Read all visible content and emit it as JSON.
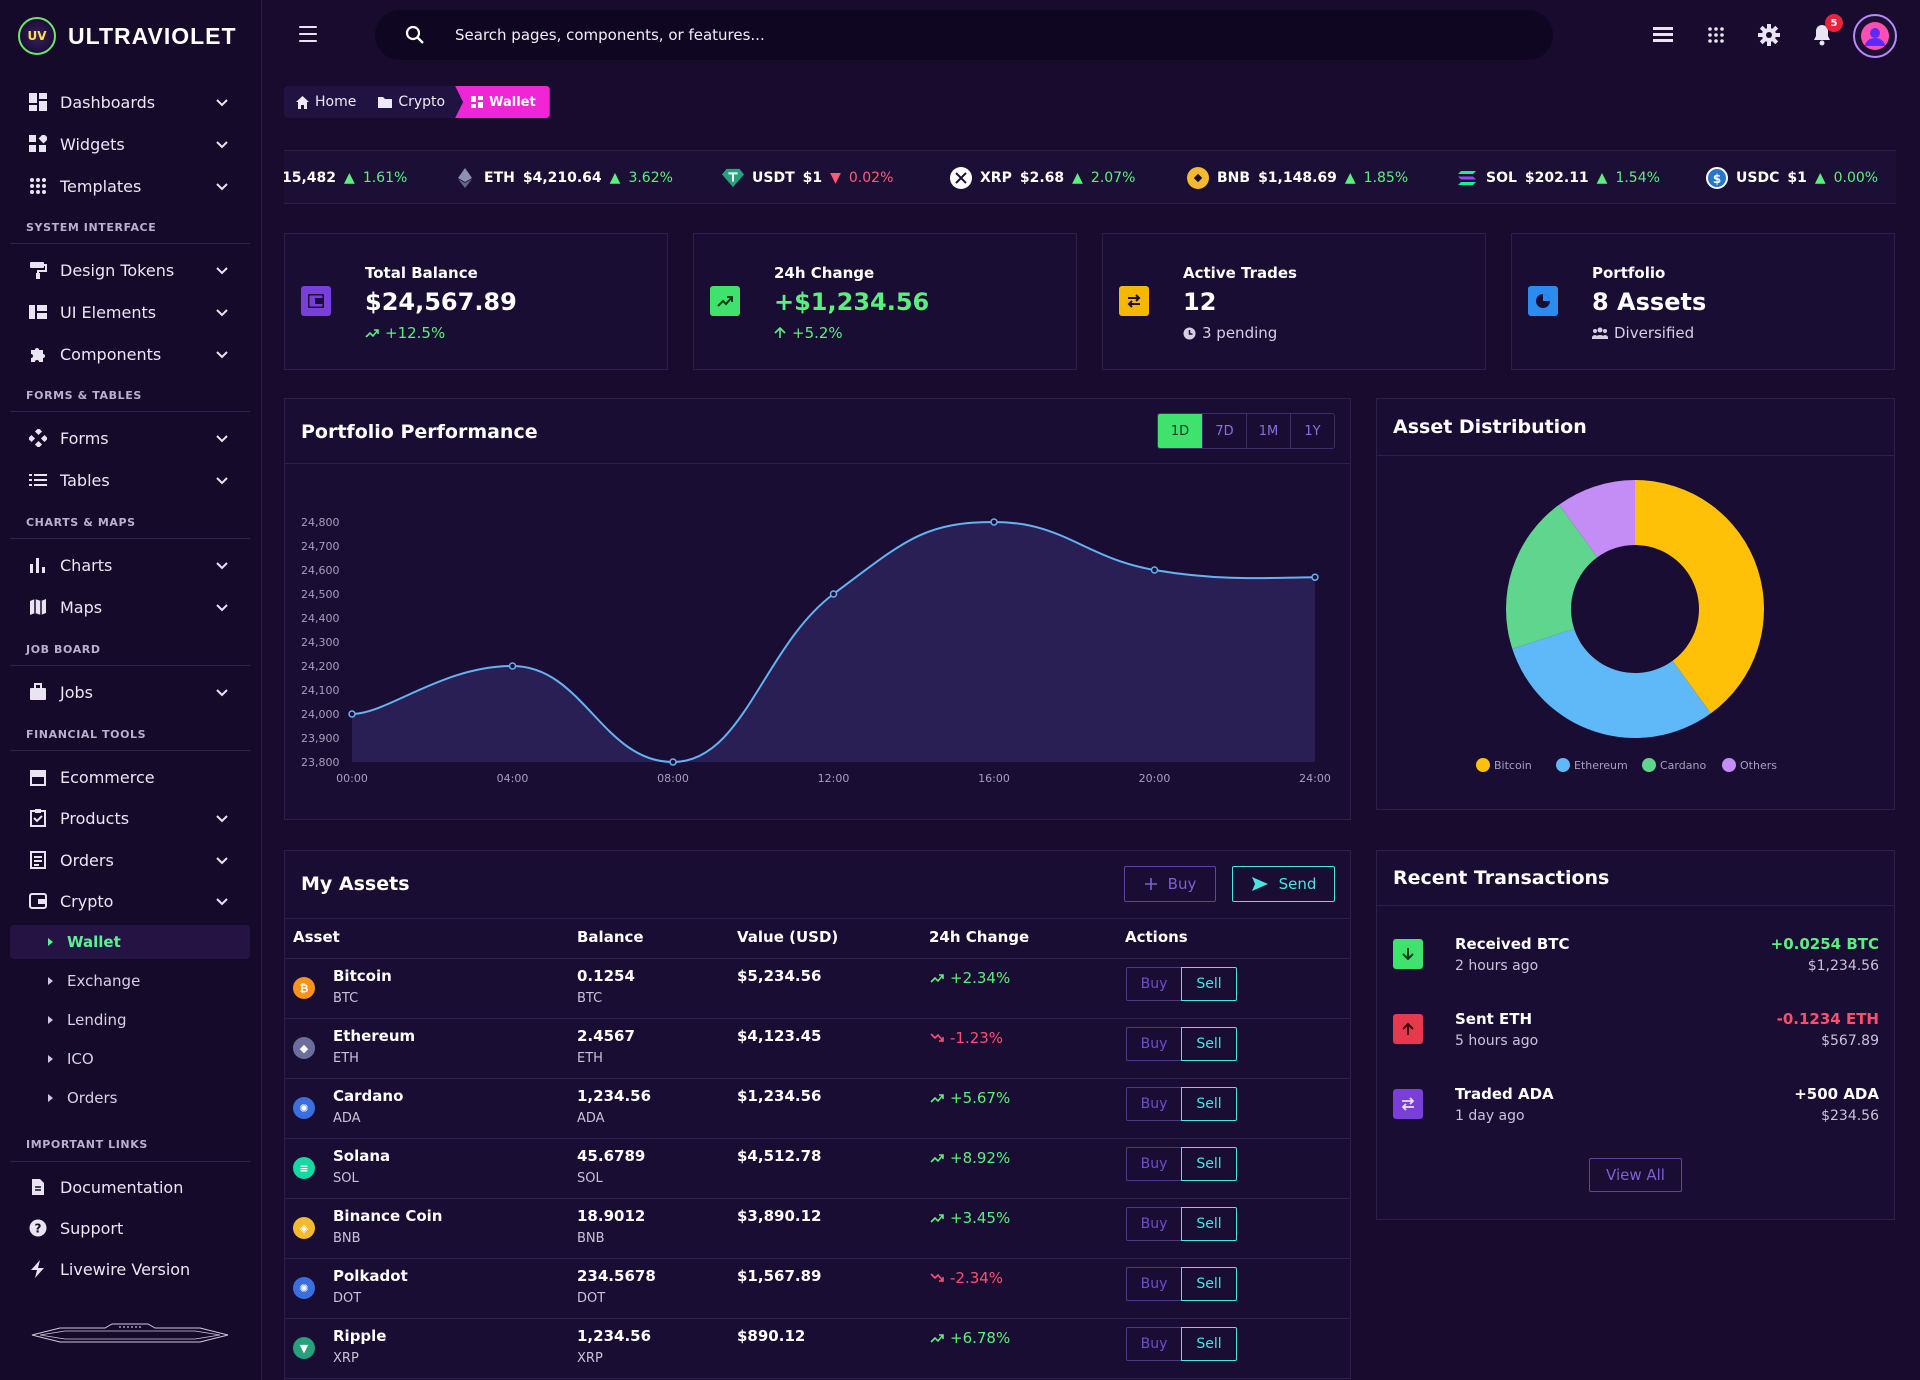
{
  "app": {
    "logo_badge": "UV",
    "name": "ULTRAVIOLET"
  },
  "sidebar": {
    "items": [
      {
        "label": "Dashboards",
        "icon": "dashboard-icon"
      },
      {
        "label": "Widgets",
        "icon": "widgets-icon"
      },
      {
        "label": "Templates",
        "icon": "grid-icon"
      },
      {
        "label": "Design Tokens",
        "icon": "paint-roller-icon"
      },
      {
        "label": "UI Elements",
        "icon": "ui-elements-icon"
      },
      {
        "label": "Components",
        "icon": "puzzle-icon"
      },
      {
        "label": "Forms",
        "icon": "forms-icon"
      },
      {
        "label": "Tables",
        "icon": "tables-icon"
      },
      {
        "label": "Charts",
        "icon": "bar-chart-icon"
      },
      {
        "label": "Maps",
        "icon": "map-icon"
      },
      {
        "label": "Jobs",
        "icon": "briefcase-icon"
      },
      {
        "label": "Ecommerce",
        "icon": "storefront-icon"
      },
      {
        "label": "Products",
        "icon": "products-icon"
      },
      {
        "label": "Orders",
        "icon": "orders-icon"
      },
      {
        "label": "Crypto",
        "icon": "wallet-icon"
      },
      {
        "label": "Documentation",
        "icon": "document-icon"
      },
      {
        "label": "Support",
        "icon": "help-icon"
      },
      {
        "label": "Livewire Version",
        "icon": "bolt-icon"
      }
    ],
    "sections": [
      "SYSTEM INTERFACE",
      "FORMS & TABLES",
      "CHARTS & MAPS",
      "JOB BOARD",
      "FINANCIAL TOOLS",
      "IMPORTANT LINKS"
    ],
    "crypto_sub": [
      "Wallet",
      "Exchange",
      "Lending",
      "ICO",
      "Orders"
    ]
  },
  "topbar": {
    "search_placeholder": "Search pages, components, or features...",
    "notification_count": "5"
  },
  "breadcrumb": [
    "Home",
    "Crypto",
    "Wallet"
  ],
  "ticker": [
    {
      "symbol": "",
      "price": "15,482",
      "change": "1.61%",
      "direction": "up",
      "color": "#f7931a"
    },
    {
      "symbol": "ETH",
      "price": "$4,210.64",
      "change": "3.62%",
      "direction": "up",
      "color": "#8a92b2"
    },
    {
      "symbol": "USDT",
      "price": "$1",
      "change": "0.02%",
      "direction": "down",
      "color": "#26a17b"
    },
    {
      "symbol": "XRP",
      "price": "$2.68",
      "change": "2.07%",
      "direction": "up",
      "color": "#ffffff"
    },
    {
      "symbol": "BNB",
      "price": "$1,148.69",
      "change": "1.85%",
      "direction": "up",
      "color": "#f3ba2f"
    },
    {
      "symbol": "SOL",
      "price": "$202.11",
      "change": "1.54%",
      "direction": "up",
      "color": "#14f195"
    },
    {
      "symbol": "USDC",
      "price": "$1",
      "change": "0.00%",
      "direction": "up",
      "color": "#2775ca"
    }
  ],
  "stats": [
    {
      "title": "Total Balance",
      "value": "$24,567.89",
      "sub": "+12.5%",
      "icon": "wallet-icon",
      "color": "#7a3fd8",
      "value_color": "#ffffff",
      "sub_color": "#5af07d"
    },
    {
      "title": "24h Change",
      "value": "+$1,234.56",
      "sub": "+5.2%",
      "icon": "trending-up-icon",
      "color": "#3ee26d",
      "value_color": "#5af07d",
      "sub_color": "#5af07d"
    },
    {
      "title": "Active Trades",
      "value": "12",
      "sub": "3 pending",
      "icon": "swap-icon",
      "color": "#f5b800",
      "value_color": "#ffffff",
      "sub_color": "#d6d0e4"
    },
    {
      "title": "Portfolio",
      "value": "8 Assets",
      "sub": "Diversified",
      "icon": "pie-chart-icon",
      "color": "#2a8cf0",
      "value_color": "#ffffff",
      "sub_color": "#d6d0e4"
    }
  ],
  "performance": {
    "title": "Portfolio Performance",
    "ranges": [
      "1D",
      "7D",
      "1M",
      "1Y"
    ],
    "active_range": "1D"
  },
  "chart_data": [
    {
      "type": "area",
      "title": "Portfolio Performance",
      "x": [
        "00:00",
        "04:00",
        "08:00",
        "12:00",
        "16:00",
        "20:00",
        "24:00"
      ],
      "values": [
        24000,
        24200,
        23800,
        24500,
        24800,
        24600,
        24570
      ],
      "yticks": [
        24800,
        24700,
        24600,
        24500,
        24400,
        24300,
        24200,
        24100,
        24000,
        23900,
        23800
      ],
      "ylim": [
        23800,
        24800
      ],
      "xlabel": "",
      "ylabel": "",
      "colors": {
        "line": "#63b3f5",
        "fill": "#2a1f55"
      }
    },
    {
      "type": "pie",
      "title": "Asset Distribution",
      "categories": [
        "Bitcoin",
        "Ethereum",
        "Cardano",
        "Others"
      ],
      "values": [
        40,
        30,
        20,
        10
      ],
      "colors": [
        "#ffc107",
        "#5fb8f7",
        "#5fd58e",
        "#c48cf5"
      ],
      "legend": "bottom"
    }
  ],
  "distribution": {
    "title": "Asset Distribution"
  },
  "assets": {
    "title": "My Assets",
    "buy_label": "Buy",
    "send_label": "Send",
    "columns": [
      "Asset",
      "Balance",
      "Value (USD)",
      "24h Change",
      "Actions"
    ],
    "rows": [
      {
        "name": "Bitcoin",
        "symbol": "BTC",
        "balance": "0.1254",
        "value": "$5,234.56",
        "change": "+2.34%",
        "dir": "pos",
        "coin_color": "#f7931a",
        "glyph": "₿"
      },
      {
        "name": "Ethereum",
        "symbol": "ETH",
        "balance": "2.4567",
        "value": "$4,123.45",
        "change": "-1.23%",
        "dir": "neg",
        "coin_color": "#6c6f9c",
        "glyph": "◆"
      },
      {
        "name": "Cardano",
        "symbol": "ADA",
        "balance": "1,234.56",
        "value": "$1,234.56",
        "change": "+5.67%",
        "dir": "pos",
        "coin_color": "#3a6fe0",
        "glyph": "✺"
      },
      {
        "name": "Solana",
        "symbol": "SOL",
        "balance": "45.6789",
        "value": "$4,512.78",
        "change": "+8.92%",
        "dir": "pos",
        "coin_color": "#14d9a0",
        "glyph": "≡"
      },
      {
        "name": "Binance Coin",
        "symbol": "BNB",
        "balance": "18.9012",
        "value": "$3,890.12",
        "change": "+3.45%",
        "dir": "pos",
        "coin_color": "#f3ba2f",
        "glyph": "◈"
      },
      {
        "name": "Polkadot",
        "symbol": "DOT",
        "balance": "234.5678",
        "value": "$1,567.89",
        "change": "-2.34%",
        "dir": "neg",
        "coin_color": "#3a6fe0",
        "glyph": "✺"
      },
      {
        "name": "Ripple",
        "symbol": "XRP",
        "balance": "1,234.56",
        "value": "$890.12",
        "change": "+6.78%",
        "dir": "pos",
        "coin_color": "#26a17b",
        "glyph": "▼"
      }
    ],
    "row_buy": "Buy",
    "row_sell": "Sell"
  },
  "transactions": {
    "title": "Recent Transactions",
    "items": [
      {
        "title": "Received BTC",
        "time": "2 hours ago",
        "amount": "+0.0254 BTC",
        "usd": "$1,234.56",
        "icon": "arrow-down-icon",
        "color": "#3ee26d",
        "amount_color": "#5af07d"
      },
      {
        "title": "Sent ETH",
        "time": "5 hours ago",
        "amount": "-0.1234 ETH",
        "usd": "$567.89",
        "icon": "arrow-up-icon",
        "color": "#e63a4c",
        "amount_color": "#ff4f6e"
      },
      {
        "title": "Traded ADA",
        "time": "1 day ago",
        "amount": "+500 ADA",
        "usd": "$234.56",
        "icon": "swap-icon",
        "color": "#7a3fd8",
        "amount_color": "#ffffff"
      }
    ],
    "view_all": "View All"
  }
}
